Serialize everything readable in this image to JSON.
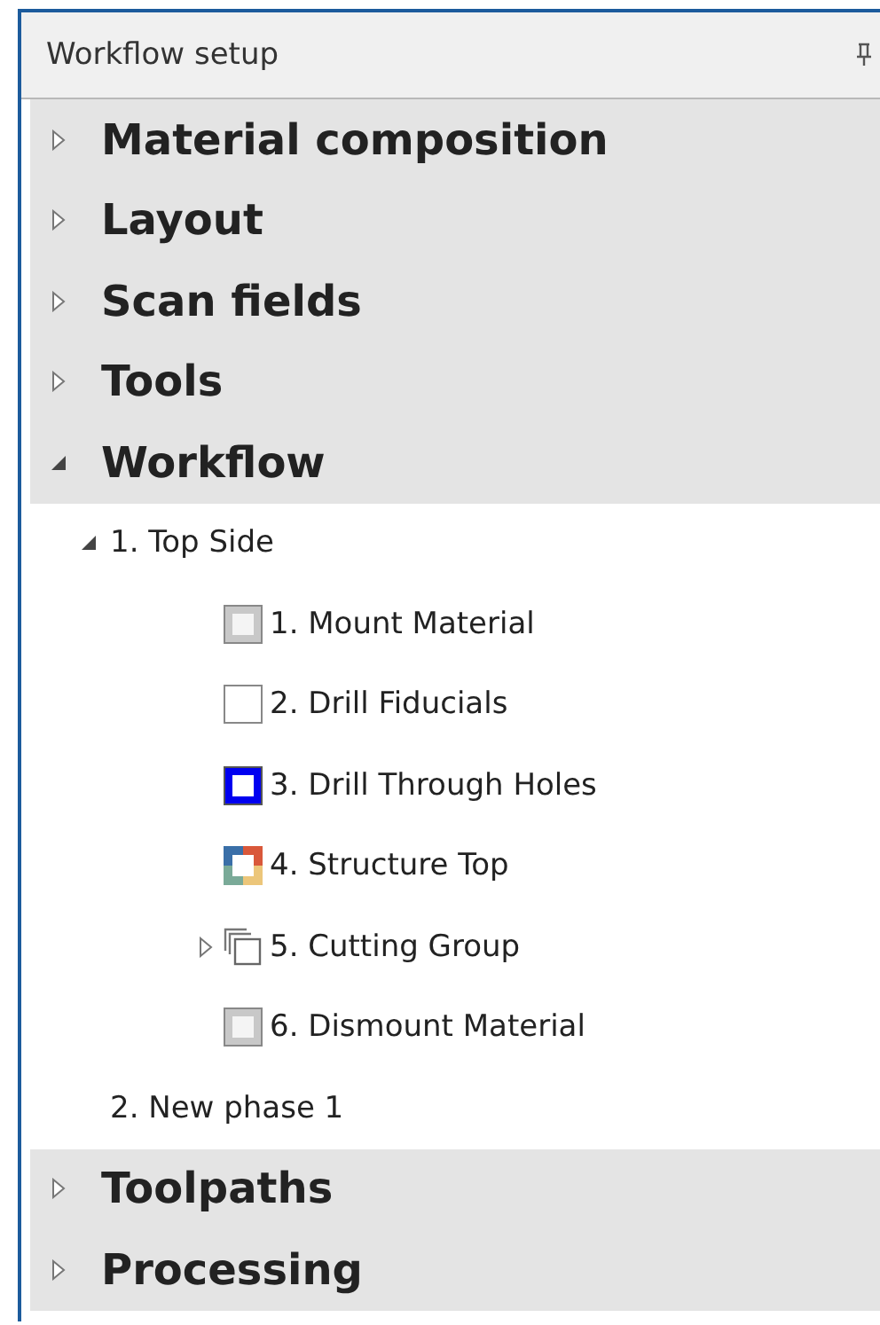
{
  "panel": {
    "title": "Workflow setup"
  },
  "sections_before": [
    {
      "label": "Material composition",
      "expanded": false
    },
    {
      "label": "Layout",
      "expanded": false
    },
    {
      "label": "Scan fields",
      "expanded": false
    },
    {
      "label": "Tools",
      "expanded": false
    },
    {
      "label": "Workflow",
      "expanded": true,
      "phases": [
        {
          "label": "1. Top Side",
          "expanded": true,
          "steps": [
            {
              "label": "1. Mount Material",
              "kind": "mount"
            },
            {
              "label": "2. Drill Fiducials",
              "kind": "plain"
            },
            {
              "label": "3. Drill Through Holes",
              "kind": "blue"
            },
            {
              "label": "4. Structure Top",
              "kind": "multicolor"
            },
            {
              "label": "5. Cutting Group",
              "kind": "group",
              "expanded": false
            },
            {
              "label": "6. Dismount Material",
              "kind": "mount"
            }
          ]
        },
        {
          "label": "2. New phase 1"
        }
      ]
    }
  ],
  "sections_after": [
    {
      "label": "Toolpaths",
      "expanded": false
    },
    {
      "label": "Processing",
      "expanded": false
    }
  ]
}
